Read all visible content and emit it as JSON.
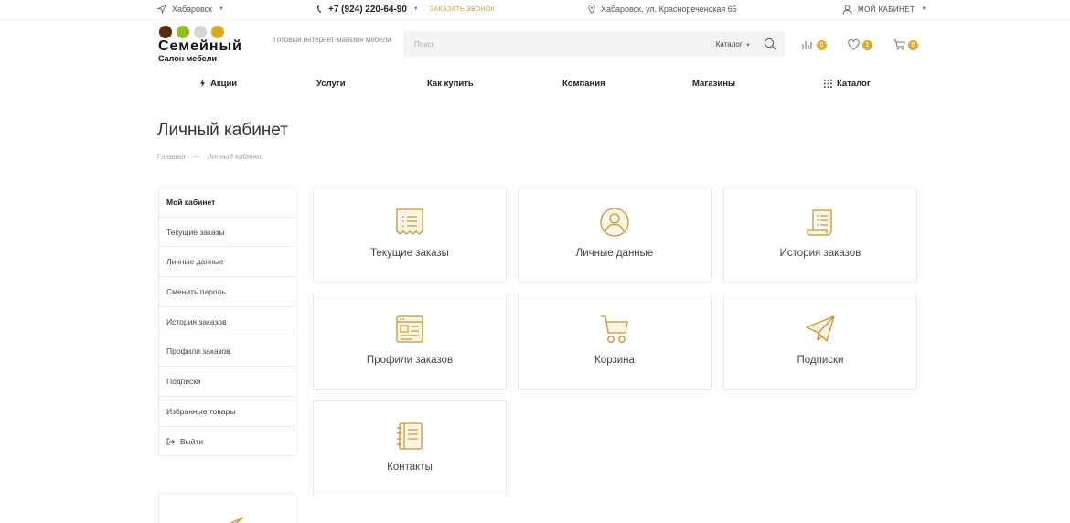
{
  "topbar": {
    "city": "Хабаровск",
    "phone": "+7 (924) 220-64-90",
    "callback": "ЗАКАЗАТЬ ЗВОНОК",
    "address": "Хабаровск, ул. Краснореченская 65",
    "account": "МОЙ КАБИНЕТ"
  },
  "logo": {
    "brand": "Семейный",
    "subtitle": "Салон мебели",
    "dot_colors": [
      "#5a2d0c",
      "#8cbf26",
      "#d6d6d6",
      "#e0a521"
    ]
  },
  "header": {
    "tagline": "Готовый интернет-магазин мебели",
    "search_placeholder": "Поиск",
    "search_category": "Каталог",
    "compare_count": "0",
    "favorites_count": "1",
    "cart_count": "0"
  },
  "nav": {
    "promo": "Акции",
    "services": "Услуги",
    "how_to_buy": "Как купить",
    "company": "Компания",
    "stores": "Магазины",
    "catalog": "Каталог"
  },
  "page": {
    "title": "Личный кабинет",
    "breadcrumb": {
      "home": "Главная",
      "separator": "—",
      "current": "Личный кабинет"
    }
  },
  "sidebar": {
    "items": [
      {
        "label": "Мой кабинет"
      },
      {
        "label": "Текущие заказы"
      },
      {
        "label": "Личные данные"
      },
      {
        "label": "Сменить пароль"
      },
      {
        "label": "История заказов"
      },
      {
        "label": "Профили заказов"
      },
      {
        "label": "Подписки"
      },
      {
        "label": "Избранные товары"
      },
      {
        "label": "Выйти"
      }
    ]
  },
  "cards": [
    {
      "label": "Текущие заказы",
      "icon": "receipt-icon"
    },
    {
      "label": "Личные данные",
      "icon": "user-icon"
    },
    {
      "label": "История заказов",
      "icon": "scroll-icon"
    },
    {
      "label": "Профили заказов",
      "icon": "profile-form-icon"
    },
    {
      "label": "Корзина",
      "icon": "cart-icon"
    },
    {
      "label": "Подписки",
      "icon": "paper-plane-icon"
    },
    {
      "label": "Контакты",
      "icon": "notebook-icon"
    }
  ],
  "colors": {
    "accent": "#c9952c",
    "badge": "#e4a72b",
    "border": "#ececec"
  }
}
